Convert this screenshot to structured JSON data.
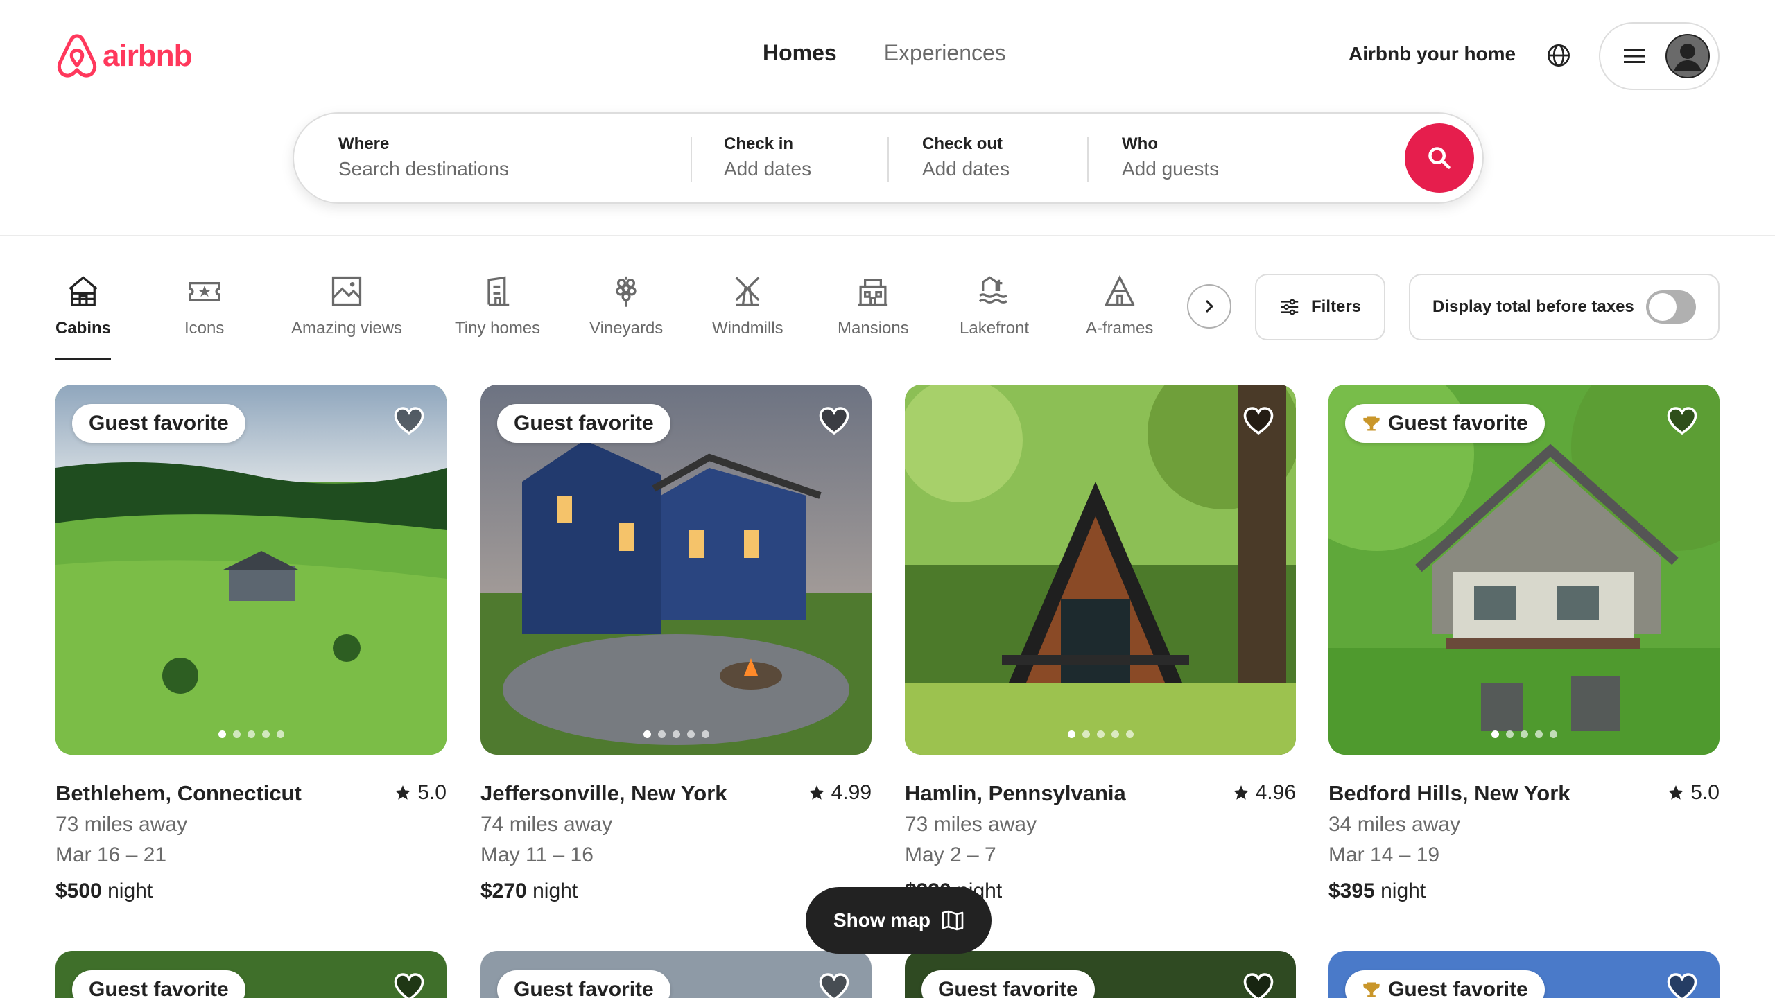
{
  "brand": {
    "name": "airbnb",
    "color": "#ff385c"
  },
  "nav": {
    "tabs": [
      {
        "label": "Homes",
        "active": true
      },
      {
        "label": "Experiences",
        "active": false
      }
    ],
    "host_link": "Airbnb your home"
  },
  "search": {
    "where": {
      "label": "Where",
      "placeholder": "Search destinations"
    },
    "checkin": {
      "label": "Check in",
      "placeholder": "Add dates"
    },
    "checkout": {
      "label": "Check out",
      "placeholder": "Add dates"
    },
    "who": {
      "label": "Who",
      "placeholder": "Add guests"
    }
  },
  "categories": [
    {
      "label": "Cabins",
      "icon": "cabin-icon",
      "active": true
    },
    {
      "label": "Icons",
      "icon": "ticket-icon"
    },
    {
      "label": "Amazing views",
      "icon": "picture-icon"
    },
    {
      "label": "Tiny homes",
      "icon": "tiny-home-icon"
    },
    {
      "label": "Vineyards",
      "icon": "grapes-icon"
    },
    {
      "label": "Windmills",
      "icon": "windmill-icon"
    },
    {
      "label": "Mansions",
      "icon": "mansion-icon"
    },
    {
      "label": "Lakefront",
      "icon": "lakefront-icon"
    },
    {
      "label": "A-frames",
      "icon": "a-frame-icon"
    }
  ],
  "filters_label": "Filters",
  "taxes_label": "Display total before taxes",
  "listings": [
    {
      "badge": "Guest favorite",
      "trophy": false,
      "location": "Bethlehem, Connecticut",
      "rating": "5.0",
      "distance": "73 miles away",
      "dates": "Mar 16 – 21",
      "price": "$500",
      "per": "night"
    },
    {
      "badge": "Guest favorite",
      "trophy": false,
      "location": "Jeffersonville, New York",
      "rating": "4.99",
      "distance": "74 miles away",
      "dates": "May 11 – 16",
      "price": "$270",
      "per": "night"
    },
    {
      "badge": "",
      "trophy": false,
      "location": "Hamlin, Pennsylvania",
      "rating": "4.96",
      "distance": "73 miles away",
      "dates": "May 2 – 7",
      "price": "$330",
      "per": "night"
    },
    {
      "badge": "Guest favorite",
      "trophy": true,
      "location": "Bedford Hills, New York",
      "rating": "5.0",
      "distance": "34 miles away",
      "dates": "Mar 14 – 19",
      "price": "$395",
      "per": "night"
    }
  ],
  "listings_row2": [
    {
      "badge": "Guest favorite",
      "trophy": false
    },
    {
      "badge": "Guest favorite",
      "trophy": false
    },
    {
      "badge": "Guest favorite",
      "trophy": false
    },
    {
      "badge": "Guest favorite",
      "trophy": true
    }
  ],
  "show_map_label": "Show map"
}
